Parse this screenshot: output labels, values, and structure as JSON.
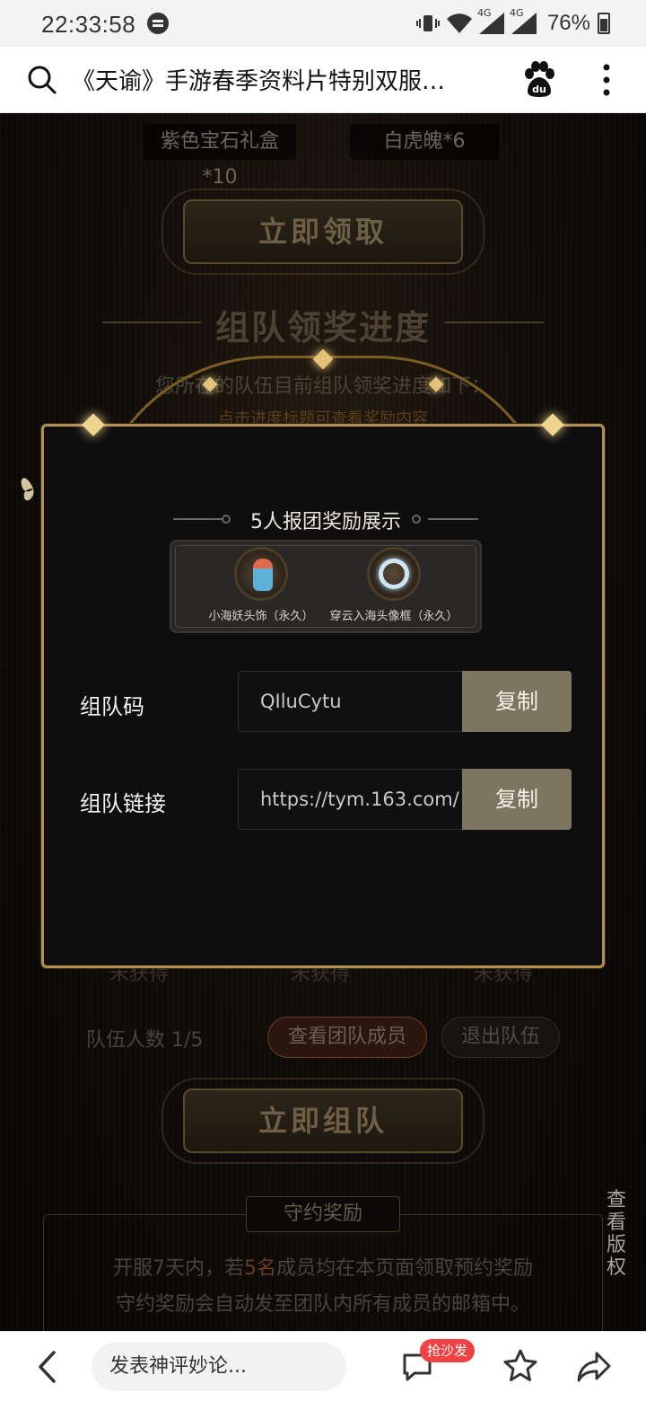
{
  "status_bar": {
    "time": "22:33:58",
    "network_4g_1": "4G",
    "network_4g_2": "4G",
    "battery": "76%"
  },
  "browser_header": {
    "title": "《天谕》手游春季资料片特别双服…"
  },
  "page": {
    "rewards_top": [
      {
        "label": "紫色宝石礼盒*10"
      },
      {
        "label": "白虎魄*6"
      }
    ],
    "claim_button": "立即领取",
    "section_title": "组队领奖进度",
    "progress_intro": "您所在的队伍目前组队领奖进度如下：",
    "progress_hint": "点击进度标题可查看奖励内容",
    "status_items": [
      "未获得",
      "未获得",
      "未获得"
    ],
    "team_count": "队伍人数 1/5",
    "view_members_button": "查看团队成员",
    "quit_team_button": "退出队伍",
    "form_team_button": "立即组队",
    "keep_promise": {
      "tag": "守约奖励",
      "line1_prefix": "开服7天内，若",
      "line1_highlight": "5名",
      "line1_suffix": "成员均在本页面领取预约奖励",
      "line2": "守约奖励会自动发至团队内所有成员的邮箱中。"
    },
    "copyright_link": "查看版权"
  },
  "modal": {
    "title": "5人报团奖励展示",
    "rewards": [
      {
        "label": "小海妖头饰（永久）",
        "icon": "sea-sprite-headwear-icon"
      },
      {
        "label": "穿云入海头像框（永久）",
        "icon": "avatar-frame-icon"
      }
    ],
    "team_code_label": "组队码",
    "team_code_value": "QIluCytu",
    "team_link_label": "组队链接",
    "team_link_value": "https://tym.163.com/",
    "copy_label": "复制",
    "copy_label_2": "复制"
  },
  "bottom_bar": {
    "comment_placeholder": "发表神评妙论...",
    "sofa_badge": "抢沙发"
  },
  "colors": {
    "gold": "#b08f55",
    "copy_button": "#7e7560",
    "badge_red": "#f04242"
  }
}
